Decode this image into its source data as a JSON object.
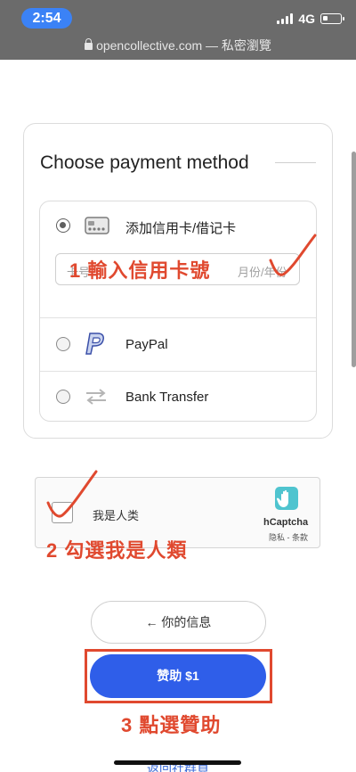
{
  "status_bar": {
    "time": "2:54",
    "network": "4G"
  },
  "browser": {
    "url": "opencollective.com — 私密瀏覽"
  },
  "payment": {
    "title": "Choose payment method",
    "methods": [
      {
        "label": "添加信用卡/借记卡",
        "selected": true,
        "icon": "credit-card-icon"
      },
      {
        "label": "PayPal",
        "selected": false,
        "icon": "paypal-icon"
      },
      {
        "label": "Bank Transfer",
        "selected": false,
        "icon": "bank-transfer-icon"
      }
    ],
    "card_input": {
      "number_placeholder": "卡号",
      "expiry_placeholder": "月份/年份"
    }
  },
  "captcha": {
    "label": "我是人类",
    "brand": "hCaptcha",
    "links": "隐私 - 条款"
  },
  "buttons": {
    "back": "← 你的信息",
    "donate": "赞助 $1"
  },
  "footer": {
    "link": "返回社群頁"
  },
  "annotations": {
    "step1": "1 輸入信用卡號",
    "step2": "2 勾選我是人類",
    "step3": "3 點選贊助",
    "color": "#e0492f"
  },
  "colors": {
    "primary": "#2f5ee9",
    "status_pill": "#3b82f6"
  }
}
